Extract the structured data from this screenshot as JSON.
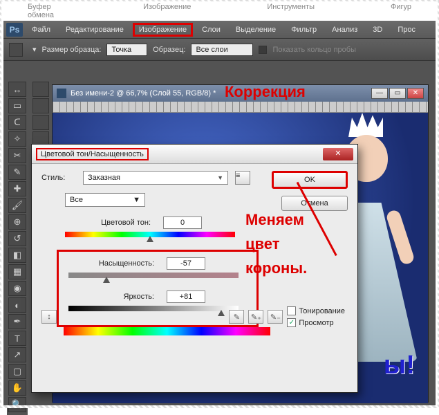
{
  "browser_labels": [
    "Буфер обмена",
    "Изображение",
    "Инструменты",
    "Фигур"
  ],
  "menu": {
    "items": [
      "Файл",
      "Редактирование",
      "Изображение",
      "Слои",
      "Выделение",
      "Фильтр",
      "Анализ",
      "3D",
      "Прос"
    ],
    "highlighted_index": 2
  },
  "options_bar": {
    "sample_label": "Размер образца:",
    "sample_value": "Точка",
    "source_label": "Образец:",
    "source_value": "Все слои",
    "ring_label": "Показать кольцо пробы"
  },
  "document": {
    "title": "Без имени-2 @ 66,7% (Слой 55, RGB/8) *"
  },
  "annotations": {
    "correction": "Коррекция",
    "main": "Меняем\nцвет\nкороны.",
    "excl": "ы!"
  },
  "dialog": {
    "title": "Цветовой тон/Насыщенность",
    "style_label": "Стиль:",
    "style_value": "Заказная",
    "ok": "OK",
    "cancel": "Отмена",
    "channel": "Все",
    "hue_label": "Цветовой тон:",
    "hue_value": "0",
    "sat_label": "Насыщенность:",
    "sat_value": "-57",
    "lig_label": "Яркость:",
    "lig_value": "+81",
    "colorize": "Тонирование",
    "preview": "Просмотр",
    "preview_checked": "✓"
  }
}
